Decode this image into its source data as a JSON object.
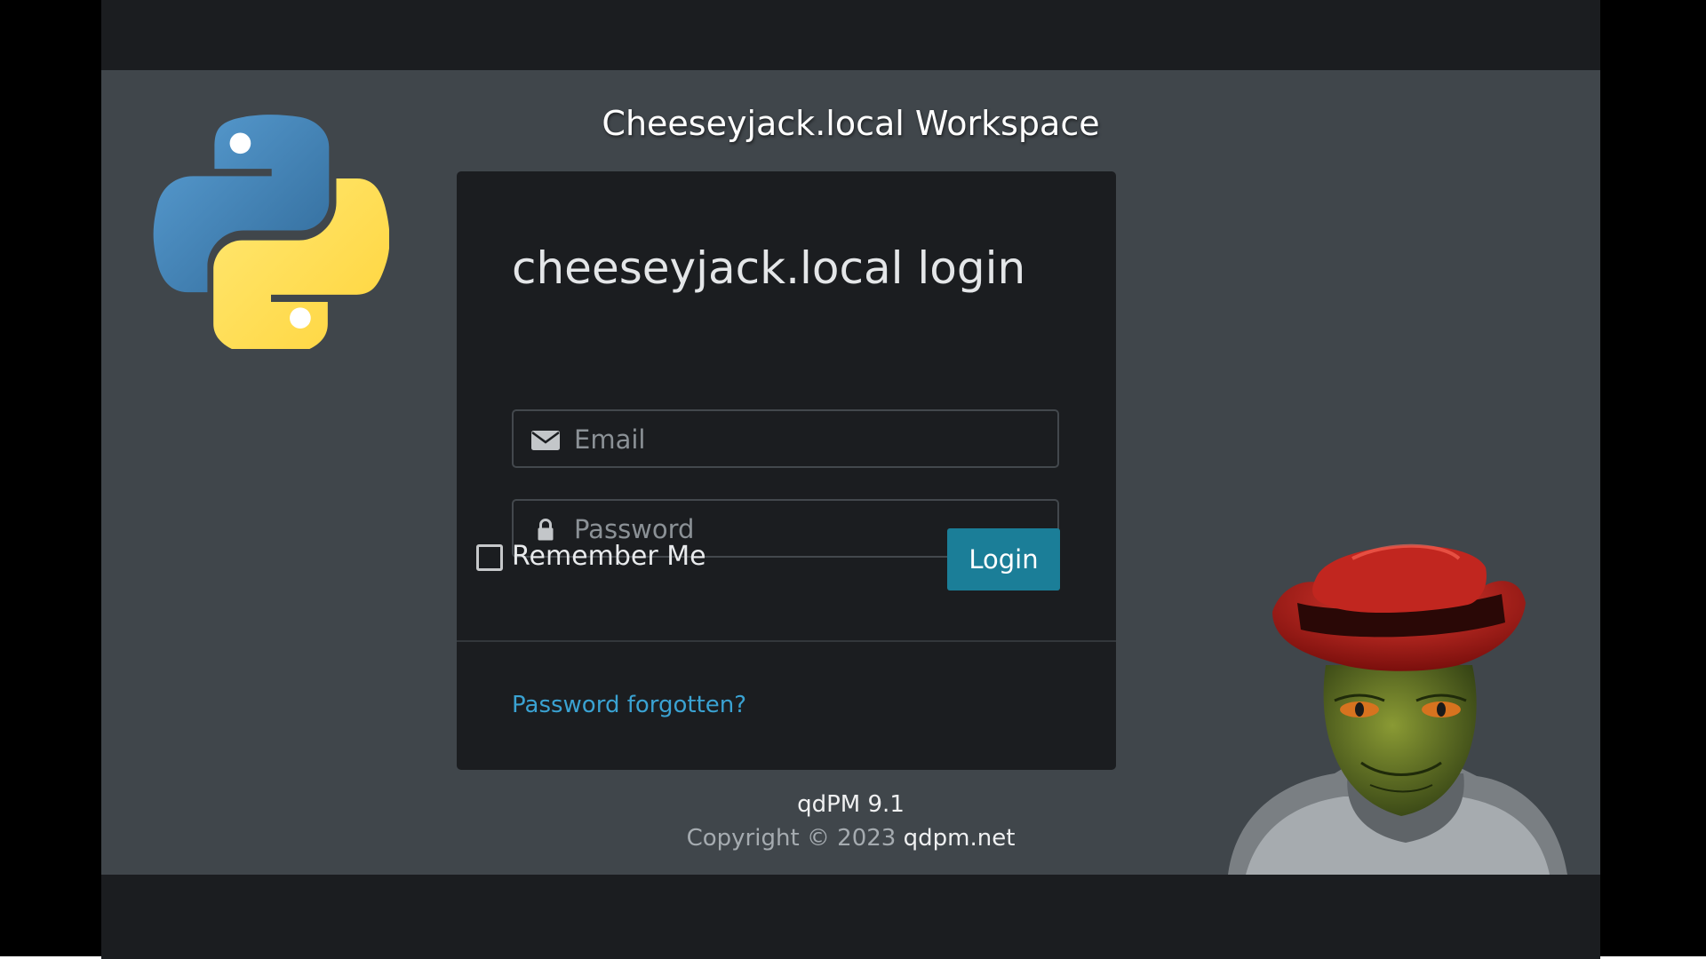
{
  "workspace_title": "Cheeseyjack.local Workspace",
  "login_card": {
    "title": "cheeseyjack.local login",
    "email_placeholder": "Email",
    "password_placeholder": "Password",
    "remember_label": "Remember Me",
    "remember_checked": false,
    "login_button": "Login",
    "forgot_link": "Password forgotten?"
  },
  "footer": {
    "version": "qdPM 9.1",
    "copyright_prefix": "Copyright © 2023",
    "site_link": "qdpm.net"
  },
  "icons": {
    "email": "envelope-icon",
    "password": "lock-icon"
  },
  "images": {
    "left_logo": "python-logo",
    "right_illustration": "lizard-mascot-red-fedora"
  },
  "colors": {
    "page_background": "#40464b",
    "frame_background": "#1b1d20",
    "card_background": "#1b1d20",
    "login_button": "#1b7e98",
    "link": "#3aa2d2",
    "python_blue": "#3a77ad",
    "python_yellow": "#f8d54c",
    "hat_red": "#b8211c"
  }
}
